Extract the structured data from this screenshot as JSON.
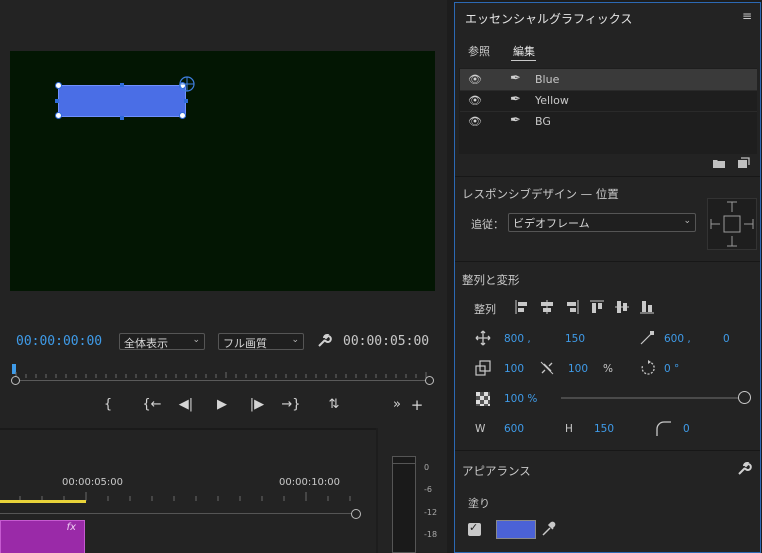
{
  "monitor": {
    "current_timecode": "00:00:00:00",
    "zoom_label": "全体表示",
    "quality_label": "フル画質",
    "duration_timecode": "00:00:05:00",
    "controls": [
      "{",
      "{←",
      "◀|",
      "▶",
      "|▶",
      "→}",
      "⇅",
      "»",
      "+"
    ]
  },
  "timeline": {
    "ruler_labels": [
      "00:00:05:00",
      "00:00:10:00"
    ],
    "clip_badge": "fx"
  },
  "meter": {
    "scale": [
      "0",
      "-6",
      "-12",
      "-18"
    ]
  },
  "essential_graphics": {
    "title": "エッセンシャルグラフィックス",
    "menu_icon": "≡",
    "tabs": [
      "参照",
      "編集"
    ],
    "active_tab": "編集",
    "layers": [
      {
        "label": "Blue",
        "selected": true
      },
      {
        "label": "Yellow",
        "selected": false
      },
      {
        "label": "BG",
        "selected": false
      }
    ],
    "responsive": {
      "title": "レスポンシブデザイン — 位置",
      "follow_label": "追従：",
      "follow_value": "ビデオフレーム"
    },
    "align": {
      "title": "整列と変形",
      "row_label": "整列",
      "position_x": "800 ,",
      "position_y": "150",
      "anchor_x": "600 ,",
      "anchor_y": "0",
      "scale_w": "100",
      "scale_h": "100",
      "scale_unit": "%",
      "rotation": "0 °",
      "opacity": "100 %",
      "w_label": "W",
      "w_value": "600",
      "h_label": "H",
      "h_value": "150",
      "corner_radius": "0"
    },
    "appearance": {
      "title": "アピアランス",
      "fill_label": "塗り",
      "fill_color": "#4b62d6"
    }
  }
}
